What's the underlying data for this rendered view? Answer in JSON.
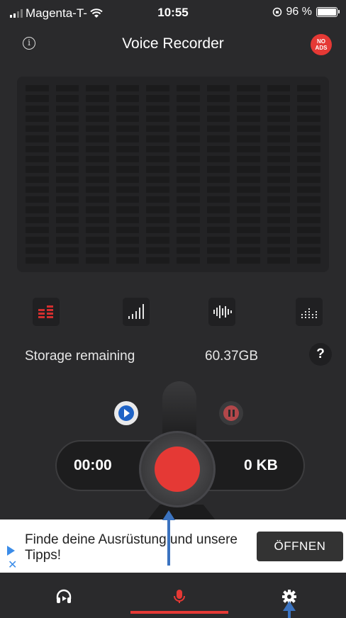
{
  "status": {
    "carrier": "Magenta-T-",
    "time": "10:55",
    "battery": "96 %"
  },
  "header": {
    "title": "Voice Recorder",
    "no_ads_line1": "NO",
    "no_ads_line2": "ADS"
  },
  "visualizer_modes": [
    "spectrum-bars-icon",
    "signal-bars-icon",
    "waveform-icon",
    "dot-bars-icon"
  ],
  "storage": {
    "label": "Storage remaining",
    "value": "60.37GB",
    "help": "?"
  },
  "recorder": {
    "elapsed": "00:00",
    "file_size": "0 KB",
    "record_color": "#e53935"
  },
  "ad": {
    "text": "Finde deine Ausrüstung und unsere Tipps!",
    "button": "ÖFFNEN"
  },
  "tabs": [
    {
      "icon": "headphones-icon"
    },
    {
      "icon": "microphone-icon",
      "active": true
    },
    {
      "icon": "gear-icon"
    }
  ],
  "colors": {
    "accent": "#e53935",
    "background": "#2a2a2c",
    "annotation_arrow": "#3b73c0"
  }
}
